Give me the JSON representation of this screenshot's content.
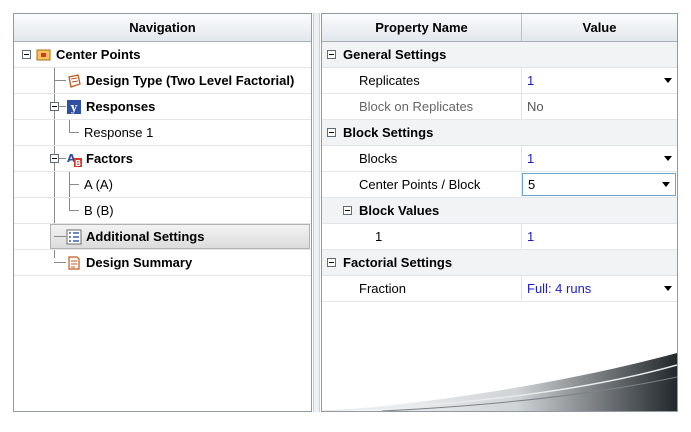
{
  "navigation": {
    "header": "Navigation",
    "items": [
      {
        "label": "Center Points"
      },
      {
        "label": "Design Type (Two Level Factorial)"
      },
      {
        "label": "Responses"
      },
      {
        "label": "Response 1"
      },
      {
        "label": "Factors"
      },
      {
        "label": "A (A)"
      },
      {
        "label": "B (B)"
      },
      {
        "label": "Additional Settings"
      },
      {
        "label": "Design Summary"
      }
    ]
  },
  "properties": {
    "header_name": "Property Name",
    "header_value": "Value",
    "general": {
      "title": "General Settings",
      "replicates": {
        "name": "Replicates",
        "value": "1"
      },
      "block_on_replicates": {
        "name": "Block on Replicates",
        "value": "No"
      }
    },
    "block": {
      "title": "Block Settings",
      "blocks": {
        "name": "Blocks",
        "value": "1"
      },
      "center_points": {
        "name": "Center Points / Block",
        "value": "5"
      },
      "values": {
        "title": "Block Values",
        "row1": {
          "name": "1",
          "value": "1"
        }
      }
    },
    "factorial": {
      "title": "Factorial Settings",
      "fraction": {
        "name": "Fraction",
        "value": "Full: 4 runs"
      }
    }
  },
  "colors": {
    "value_text": "#1c1ccc",
    "edit_border": "#6aa7d6"
  }
}
